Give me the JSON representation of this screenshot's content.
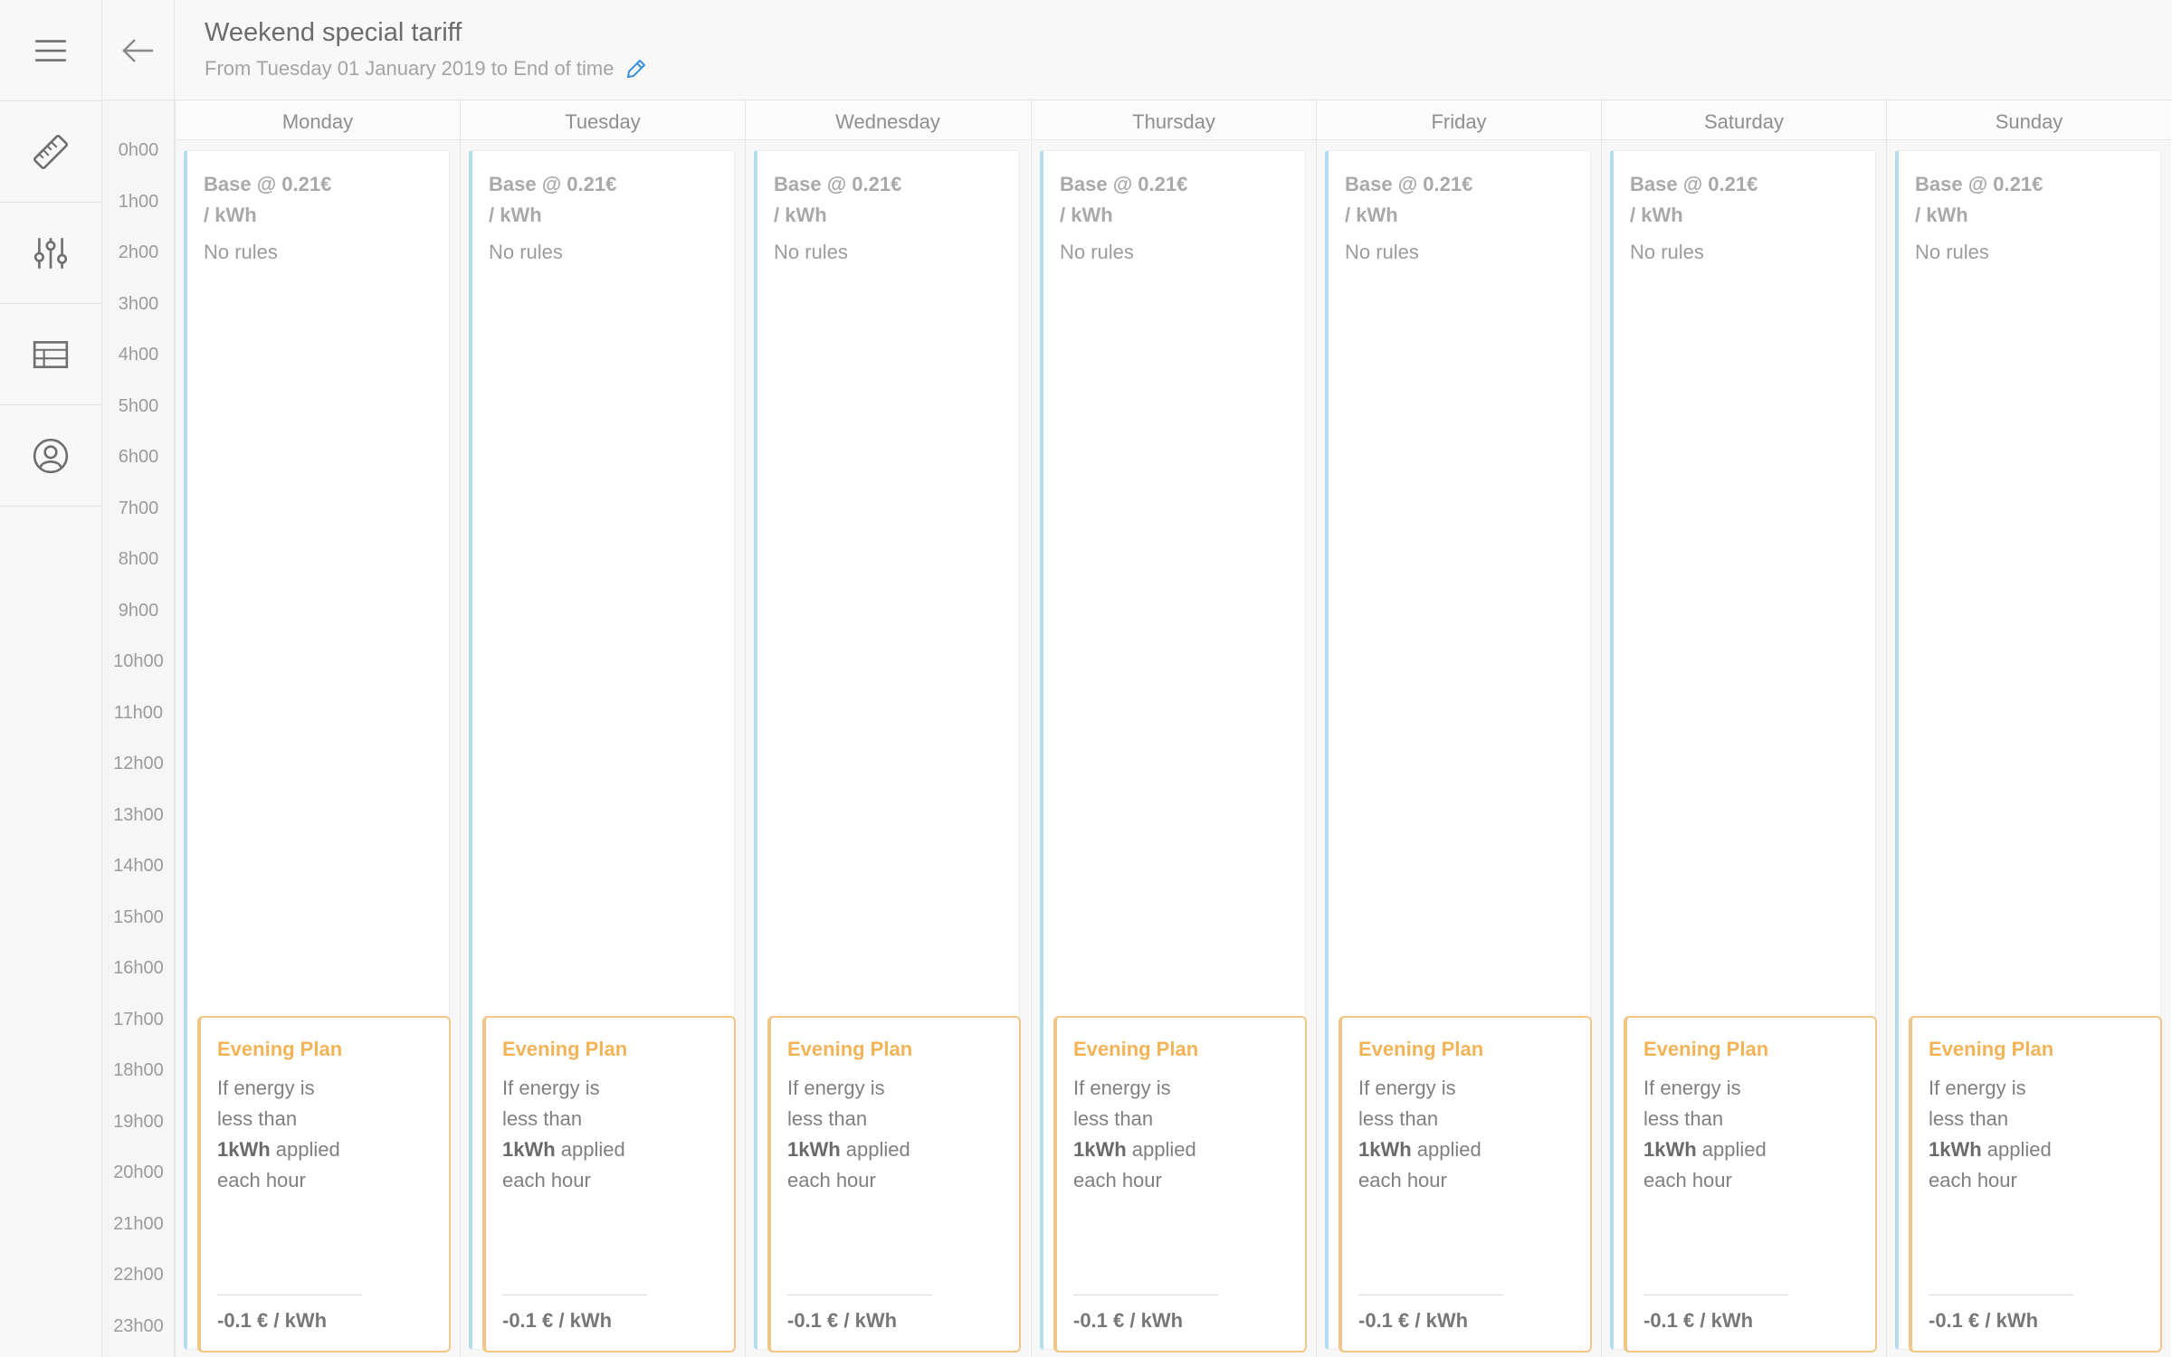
{
  "header": {
    "title": "Weekend special tariff",
    "subtitle": "From Tuesday 01 January 2019 to End of time"
  },
  "nav": {
    "icons": [
      "menu-icon",
      "back-arrow-icon",
      "ruler-icon",
      "sliders-icon",
      "table-icon",
      "user-circle-icon",
      "pencil-icon"
    ]
  },
  "hours": [
    "0h00",
    "1h00",
    "2h00",
    "3h00",
    "4h00",
    "5h00",
    "6h00",
    "7h00",
    "8h00",
    "9h00",
    "10h00",
    "11h00",
    "12h00",
    "13h00",
    "14h00",
    "15h00",
    "16h00",
    "17h00",
    "18h00",
    "19h00",
    "20h00",
    "21h00",
    "22h00",
    "23h00"
  ],
  "base": {
    "name_line1": "Base @ 0.21€",
    "name_line2": "/ kWh",
    "rules": "No rules"
  },
  "evening": {
    "title": "Evening Plan",
    "desc_line1": "If energy is",
    "desc_line2": "less than",
    "desc_bold": "1kWh",
    "desc_rest": " applied",
    "desc_line4": "each hour",
    "price": "-0.1 € / kWh"
  },
  "days": [
    {
      "label": "Monday"
    },
    {
      "label": "Tuesday"
    },
    {
      "label": "Wednesday"
    },
    {
      "label": "Thursday"
    },
    {
      "label": "Friday"
    },
    {
      "label": "Saturday"
    },
    {
      "label": "Sunday"
    }
  ],
  "colors": {
    "base_accent": "#b5dbef",
    "evening_accent": "#f0c788",
    "evening_title": "#f2b457",
    "edit_icon": "#3a8fd8"
  }
}
